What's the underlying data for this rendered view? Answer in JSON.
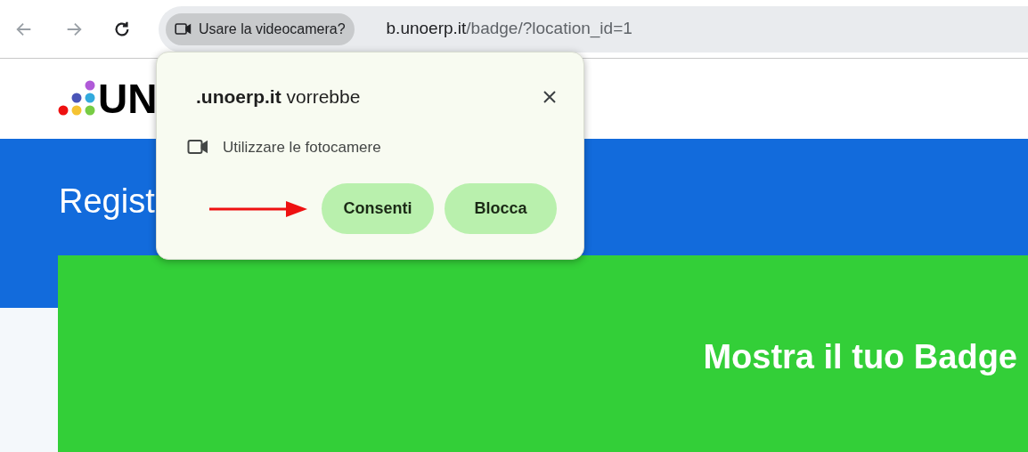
{
  "toolbar": {
    "camera_chip": "Usare la videocamera?",
    "url_host": "b.unoerp.it",
    "url_path": "/badge/?location_id=1"
  },
  "page": {
    "logo_text": "UN",
    "banner_title": "Regist",
    "card_title": "Mostra il tuo Badge"
  },
  "permission_popup": {
    "site": ".unoerp.it",
    "title_rest": " vorrebbe",
    "request": "Utilizzare le fotocamere",
    "buttons": [
      "Consenti",
      "Blocca"
    ]
  }
}
